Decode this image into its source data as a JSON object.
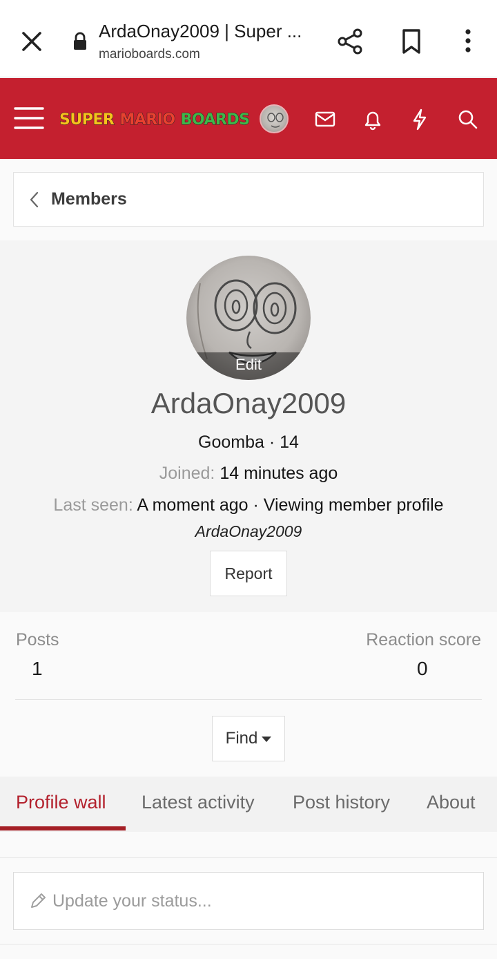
{
  "browser": {
    "title": "ArdaOnay2009 | Super ...",
    "url": "marioboards.com",
    "icons": [
      "close-icon",
      "lock-icon",
      "share-icon",
      "bookmark-icon",
      "more-icon"
    ]
  },
  "header": {
    "logo_text": [
      "SUPER",
      "MARIO",
      "BOARDS"
    ],
    "icons": [
      "menu-icon",
      "avatar",
      "envelope-icon",
      "bell-icon",
      "lightning-icon",
      "search-icon"
    ],
    "background": "#c4202f"
  },
  "breadcrumb": {
    "label": "Members"
  },
  "profile": {
    "edit_label": "Edit",
    "username": "ArdaOnay2009",
    "title_line": "Goomba · 14",
    "joined_label": "Joined:",
    "joined_value": "14 minutes ago",
    "lastseen_label": "Last seen:",
    "lastseen_value": "A moment ago · Viewing member profile",
    "activity_target": "ArdaOnay2009",
    "report_label": "Report"
  },
  "stats": {
    "posts_label": "Posts",
    "posts_value": "1",
    "reaction_label": "Reaction score",
    "reaction_value": "0"
  },
  "find_label": "Find",
  "tabs": [
    {
      "label": "Profile wall",
      "active": true
    },
    {
      "label": "Latest activity",
      "active": false
    },
    {
      "label": "Post history",
      "active": false
    },
    {
      "label": "About",
      "active": false
    }
  ],
  "status": {
    "placeholder": "Update your status..."
  },
  "colors": {
    "accent": "#c4202f",
    "active_tab": "#b3212d"
  }
}
